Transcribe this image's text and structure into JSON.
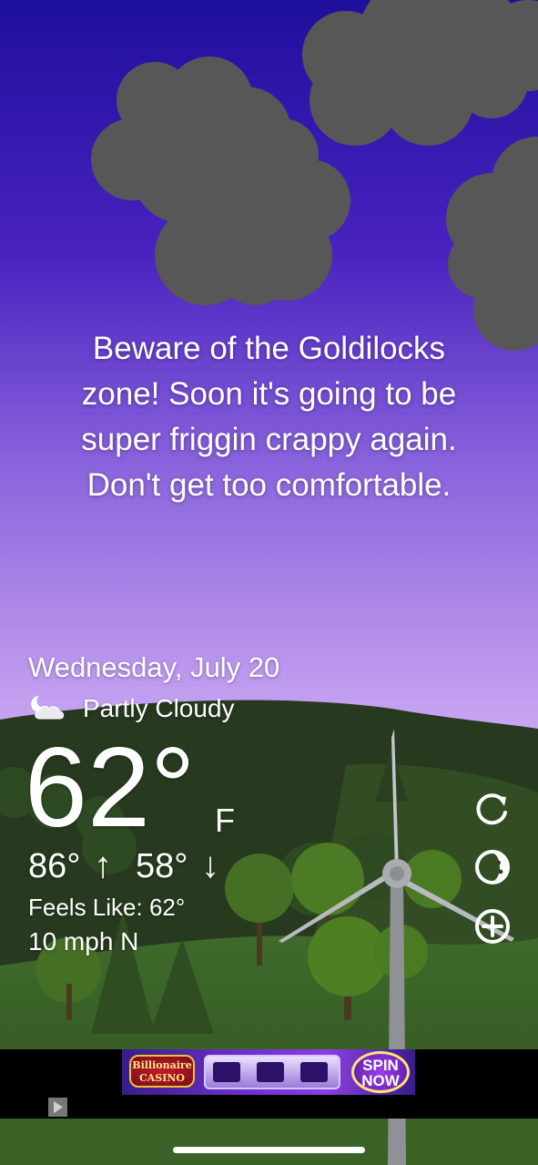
{
  "message": {
    "lines": [
      "Beware of the Goldilocks",
      "zone! Soon it's going to be",
      "super friggin crappy again.",
      "Don't get too comfortable."
    ]
  },
  "weather": {
    "date": "Wednesday, July 20",
    "condition": "Partly Cloudy",
    "condition_icon": "partly-cloudy-night-icon",
    "temperature": "62°",
    "unit": "F",
    "high": "86°",
    "high_arrow": "↑",
    "low": "58°",
    "low_arrow": "↓",
    "feels_like": "Feels Like: 62°",
    "wind": "10 mph N"
  },
  "controls": {
    "refresh_icon": "refresh-icon",
    "moon_icon": "moon-phase-icon",
    "add_icon": "add-location-icon"
  },
  "ad": {
    "brand_line1": "Billionaire",
    "brand_line2": "CASINO",
    "cta_line1": "SPIN",
    "cta_line2": "NOW"
  },
  "colors": {
    "sky_top": "#1e0f9c",
    "sky_mid": "#6a3fd0",
    "sky_bottom": "#c9a6f2",
    "cloud": "#555555",
    "hill_dark": "#263b20",
    "hill_light": "#3f6b2a",
    "tree": "#4a7a20"
  }
}
